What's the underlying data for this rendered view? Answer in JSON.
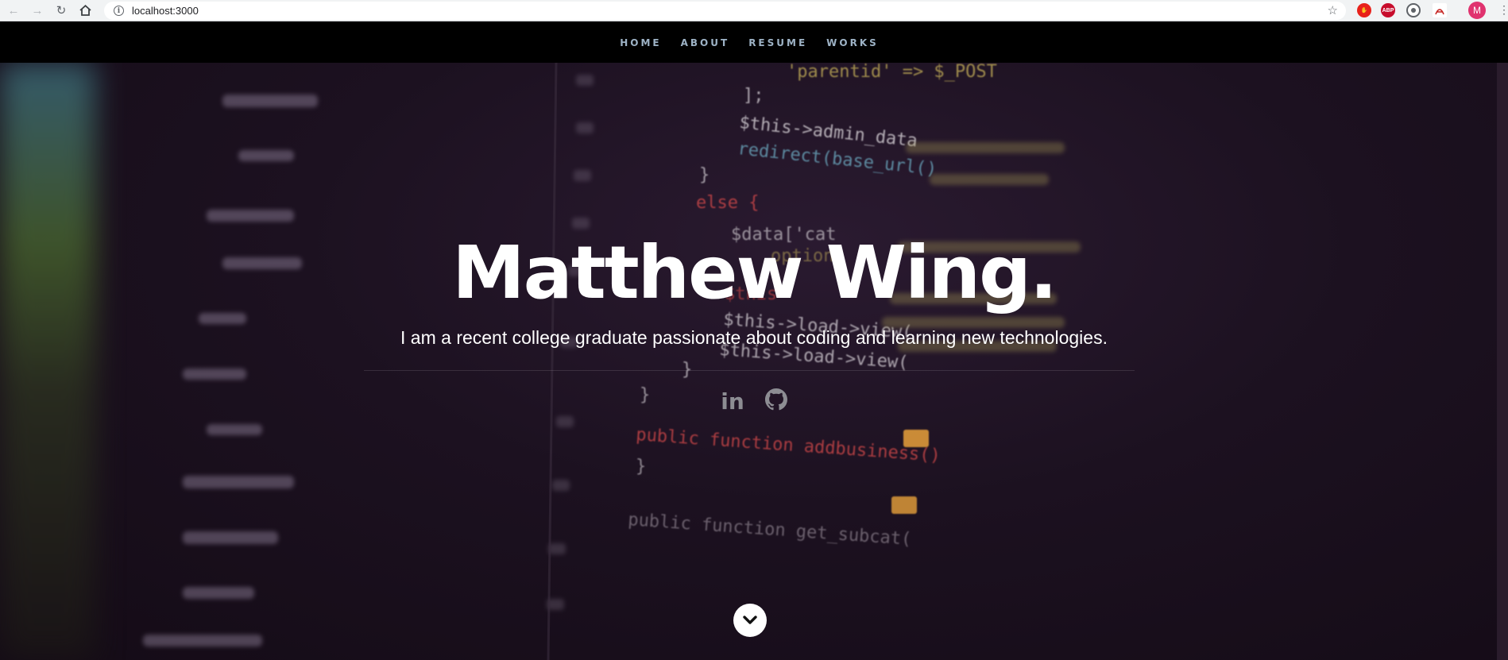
{
  "browser": {
    "url": "localhost:3000",
    "back_icon": "arrow-left-icon",
    "forward_icon": "arrow-right-icon",
    "reload_icon": "reload-icon",
    "home_icon": "home-icon",
    "profile_initial": "M",
    "extensions": [
      {
        "name": "stop-extension-icon",
        "color": "#e8211a",
        "label": ""
      },
      {
        "name": "adblock-plus-icon",
        "color": "#c70d2c",
        "label": "ABP"
      },
      {
        "name": "target-extension-icon",
        "color": "#5f6368",
        "label": ""
      },
      {
        "name": "pdf-extension-icon",
        "color": "#c5221f",
        "label": ""
      }
    ]
  },
  "nav": {
    "items": [
      "HOME",
      "ABOUT",
      "RESUME",
      "WORKS"
    ]
  },
  "hero": {
    "title": "Matthew Wing.",
    "subtitle": "I am a recent college graduate passionate about coding and learning new technologies.",
    "social": [
      {
        "name": "linkedin-icon",
        "glyph": "in"
      },
      {
        "name": "github-icon",
        "glyph": ""
      }
    ],
    "scroll_icon": "chevron-down-icon"
  },
  "code_lines": [
    "'parentid'  => $_POST",
    "];",
    "$this->admin_data",
    "redirect(base_url()",
    "}",
    "else {",
    "$data['cat",
    "options",
    "$this",
    "$this->load->view(",
    "$this->load->view(",
    "}",
    "}",
    "public function addbusiness()",
    "}",
    "public function get_subcat("
  ],
  "colors": {
    "accent": "#9eb3c6",
    "background": "#1c1120"
  }
}
